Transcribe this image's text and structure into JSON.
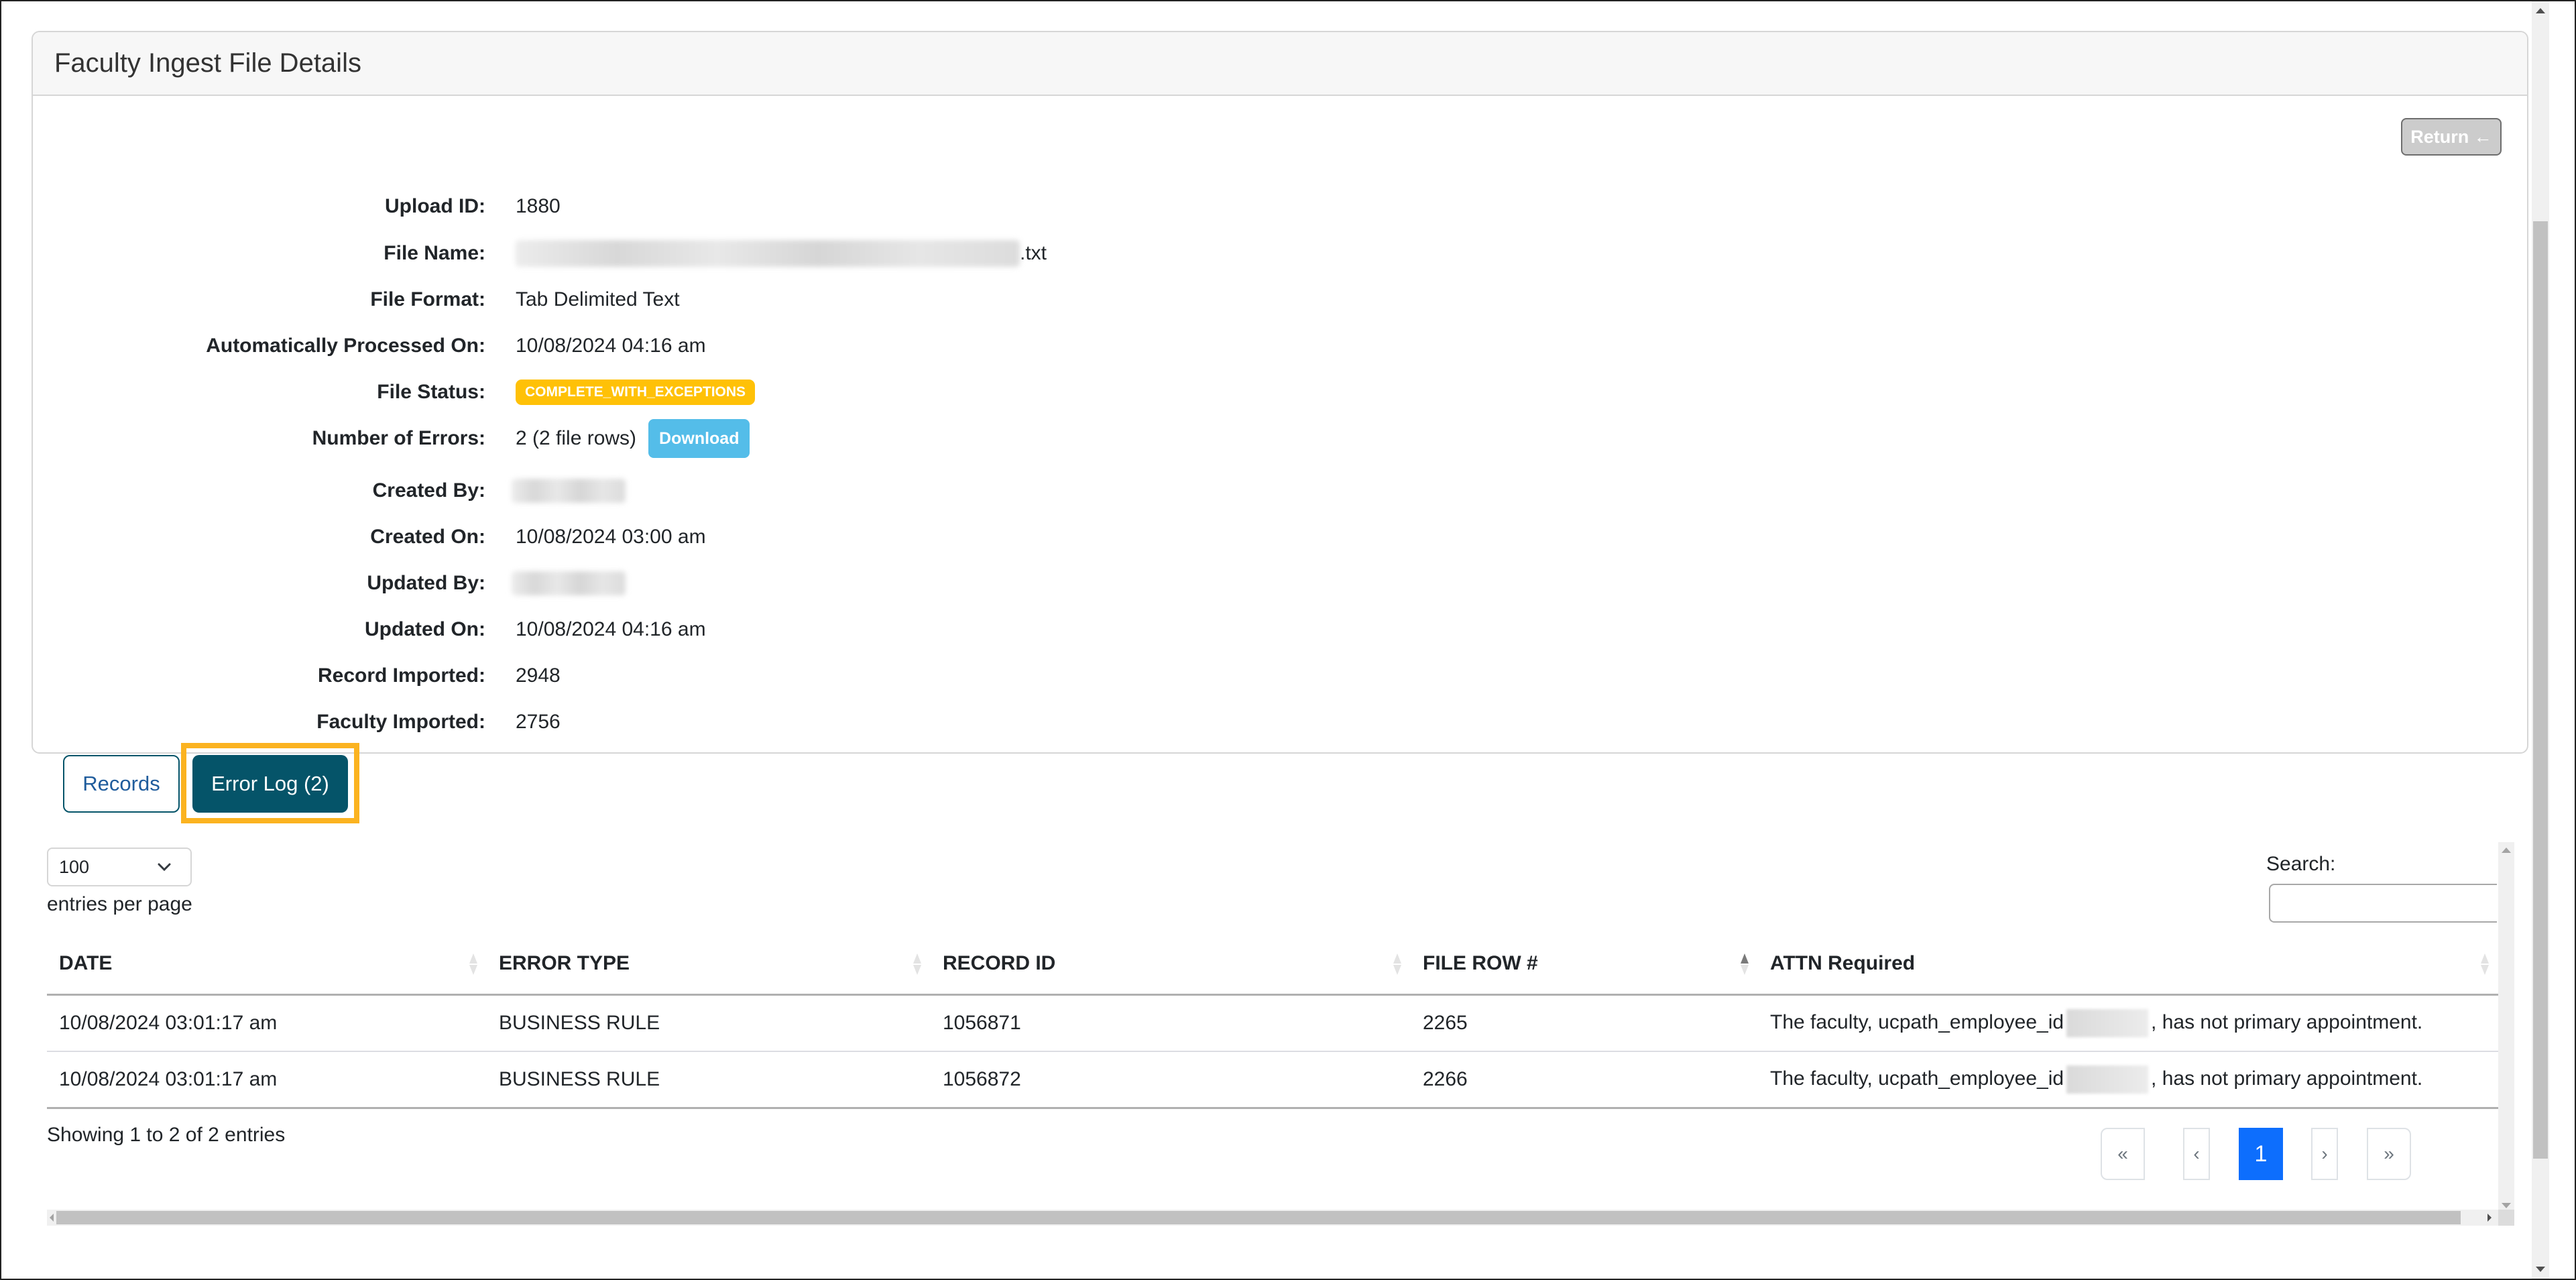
{
  "card": {
    "title": "Faculty Ingest File Details",
    "return_label": "Return ←"
  },
  "details": [
    {
      "label": "Upload ID:",
      "value": "1880"
    },
    {
      "label": "File Name:",
      "value": ".txt",
      "redacted_prefix": true
    },
    {
      "label": "File Format:",
      "value": "Tab Delimited Text"
    },
    {
      "label": "Automatically Processed On:",
      "value": "10/08/2024 04:16 am"
    },
    {
      "label": "File Status:",
      "value": "COMPLETE_WITH_EXCEPTIONS"
    },
    {
      "label": "Number of Errors:",
      "value": "2 (2 file rows)",
      "action": "Download"
    },
    {
      "label": "Created By:",
      "value": "",
      "redacted": true
    },
    {
      "label": "Created On:",
      "value": "10/08/2024 03:00 am"
    },
    {
      "label": "Updated By:",
      "value": "",
      "redacted": true
    },
    {
      "label": "Updated On:",
      "value": "10/08/2024 04:16 am"
    },
    {
      "label": "Record Imported:",
      "value": "2948"
    },
    {
      "label": "Faculty Imported:",
      "value": "2756"
    }
  ],
  "tabs": [
    {
      "label": "Records",
      "active": false
    },
    {
      "label": "Error Log (2)",
      "active": true
    }
  ],
  "table_controls": {
    "length_value": "100",
    "length_label": "entries per page",
    "search_label": "Search:",
    "search_value": ""
  },
  "table": {
    "columns": [
      "DATE",
      "ERROR TYPE",
      "RECORD ID",
      "FILE ROW #",
      "ATTN Required"
    ],
    "sorted_column": "FILE ROW #",
    "sort_direction": "asc",
    "rows": [
      {
        "date": "10/08/2024 03:01:17 am",
        "error_type": "BUSINESS RULE",
        "record_id": "1056871",
        "file_row": "2265",
        "attn_prefix": "The faculty, ucpath_employee_id",
        "attn_suffix": ", has not primary appointment."
      },
      {
        "date": "10/08/2024 03:01:17 am",
        "error_type": "BUSINESS RULE",
        "record_id": "1056872",
        "file_row": "2266",
        "attn_prefix": "The faculty, ucpath_employee_id",
        "attn_suffix": ", has not primary appointment."
      }
    ]
  },
  "footer": {
    "info": "Showing 1 to 2 of 2 entries",
    "pagination": {
      "first": "«",
      "prev": "‹",
      "current": "1",
      "next": "›",
      "last": "»"
    }
  },
  "colors": {
    "status_badge": "#ffc107",
    "download_button": "#54bde9",
    "active_tab": "#055469",
    "highlight": "#fbb320",
    "active_page": "#0d6efd"
  }
}
